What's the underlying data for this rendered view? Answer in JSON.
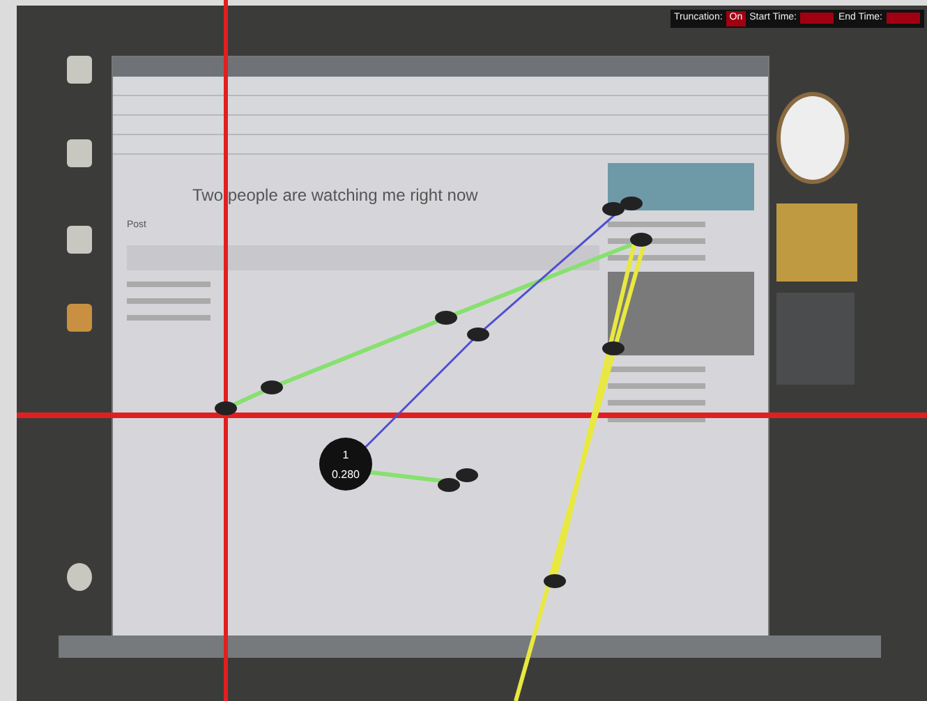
{
  "overlay_info": {
    "labels": [
      {
        "text": "Truncation:",
        "highlighted": false
      },
      {
        "text": "On",
        "highlighted": true
      },
      {
        "text": "Start Time:",
        "highlighted": false
      },
      {
        "text": "End Time:",
        "highlighted": false
      }
    ]
  },
  "browser": {
    "post_title": "Two people are watching me right now",
    "editor_label": "Post"
  },
  "fixation_label": {
    "index": "1",
    "value": "0.280"
  },
  "scanpaths": [
    {
      "color": "#88e070"
    },
    {
      "color": "#5050d0"
    },
    {
      "color": "#e8e840"
    }
  ]
}
